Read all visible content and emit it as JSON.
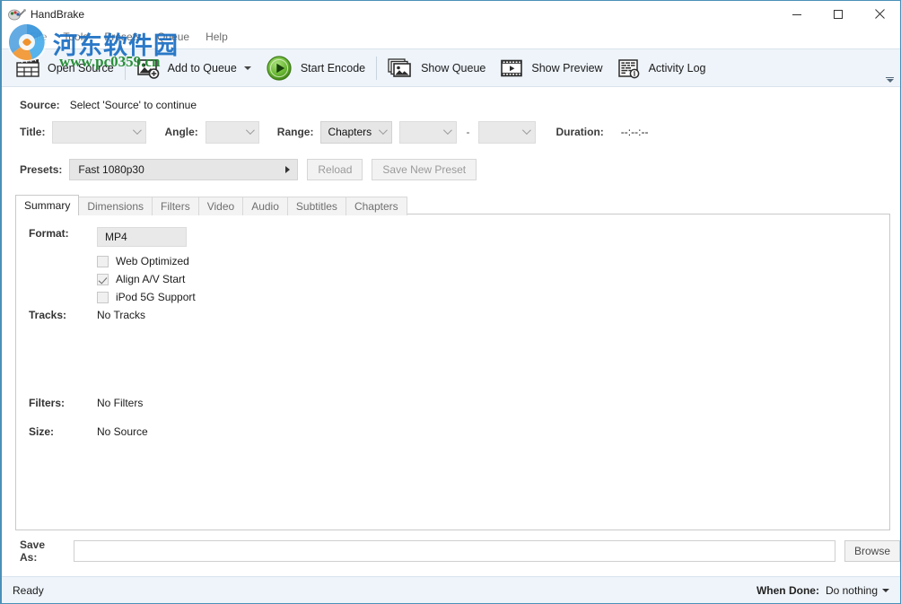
{
  "window": {
    "title": "HandBrake",
    "controls": {
      "minimize": "minimize-icon",
      "maximize": "maximize-icon",
      "close": "close-icon"
    }
  },
  "menubar": {
    "items": [
      {
        "label": "File"
      },
      {
        "label": "Tools"
      },
      {
        "label": "Presets"
      },
      {
        "label": "Queue"
      },
      {
        "label": "Help"
      }
    ]
  },
  "toolbar": {
    "buttons": [
      {
        "label": "Open Source",
        "icon": "clapperboard-icon",
        "caret": false
      },
      {
        "label": "Add to Queue",
        "icon": "add-image-icon",
        "caret": true
      },
      {
        "label": "Start Encode",
        "icon": "green-play-icon",
        "caret": false
      },
      {
        "label": "Show Queue",
        "icon": "stacked-images-icon",
        "caret": false
      },
      {
        "label": "Show Preview",
        "icon": "film-play-icon",
        "caret": false
      },
      {
        "label": "Activity Log",
        "icon": "log-info-icon",
        "caret": false
      }
    ],
    "overflow_icon": "toolbar-overflow-icon"
  },
  "source": {
    "label": "Source:",
    "value": "Select 'Source' to continue"
  },
  "meta": {
    "title_label": "Title:",
    "title_value": "",
    "angle_label": "Angle:",
    "angle_value": "",
    "range_label": "Range:",
    "range_value": "Chapters",
    "range_start": "",
    "range_separator": "-",
    "range_end": "",
    "duration_label": "Duration:",
    "duration_value": "--:--:--"
  },
  "presets": {
    "label": "Presets:",
    "selected": "Fast 1080p30",
    "reload_label": "Reload",
    "save_new_label": "Save New Preset"
  },
  "tabs": [
    {
      "label": "Summary",
      "active": true
    },
    {
      "label": "Dimensions",
      "active": false
    },
    {
      "label": "Filters",
      "active": false
    },
    {
      "label": "Video",
      "active": false
    },
    {
      "label": "Audio",
      "active": false
    },
    {
      "label": "Subtitles",
      "active": false
    },
    {
      "label": "Chapters",
      "active": false
    }
  ],
  "summary": {
    "format_label": "Format:",
    "format_value": "MP4",
    "checkboxes": [
      {
        "label": "Web Optimized",
        "checked": false
      },
      {
        "label": "Align A/V Start",
        "checked": true
      },
      {
        "label": "iPod 5G Support",
        "checked": false
      }
    ],
    "tracks_label": "Tracks:",
    "tracks_value": "No Tracks",
    "filters_label": "Filters:",
    "filters_value": "No Filters",
    "size_label": "Size:",
    "size_value": "No Source"
  },
  "saveas": {
    "label": "Save As:",
    "value": "",
    "placeholder": "",
    "browse_label": "Browse"
  },
  "statusbar": {
    "status": "Ready",
    "when_done_label": "When Done:",
    "when_done_value": "Do nothing"
  },
  "watermark": {
    "site_name": "河东软件园",
    "url": "www.pc0359.cn"
  },
  "colors": {
    "toolbar_bg": "#eef4fa",
    "window_border": "#4a90b8",
    "encode_green": "#5aa830",
    "watermark_blue": "#1b6fc4",
    "watermark_green": "#1f8a2e"
  }
}
